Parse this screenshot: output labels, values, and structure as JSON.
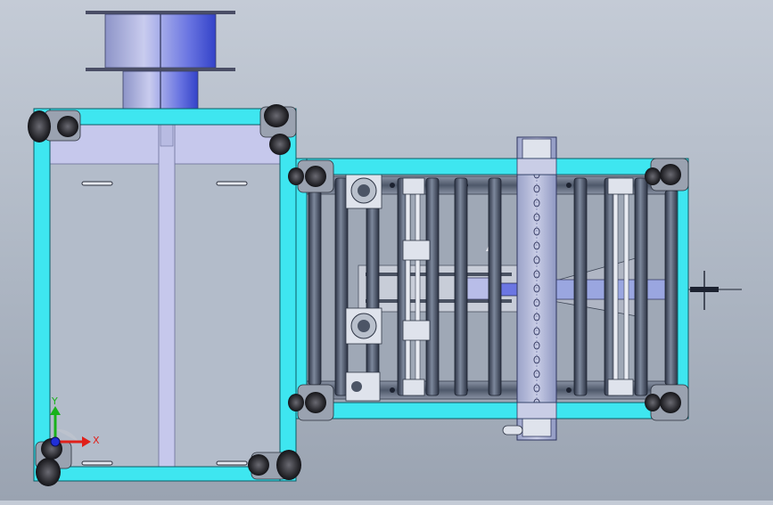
{
  "viewport": {
    "background": [
      "#c4cbd6",
      "#9aa3b1"
    ]
  },
  "colors": {
    "frame_cyan": "#3ee6f0",
    "frame_edge": "#0c5c66",
    "plate_lilac": "#c6c8ec",
    "roller_dark": "#3b4456",
    "roller_mid": "#6c7688",
    "spool_blue": "#4d5bd8",
    "caster_black": "#1e1e22"
  },
  "triad": {
    "x_label": "X",
    "y_label": "Y",
    "x_color": "#e0201a",
    "y_color": "#18b21a",
    "origin_color": "#1f2fd8"
  },
  "icons": [
    "spool",
    "caster-wheel",
    "roller",
    "bearing-block",
    "chain",
    "coordinate-triad-icon"
  ]
}
